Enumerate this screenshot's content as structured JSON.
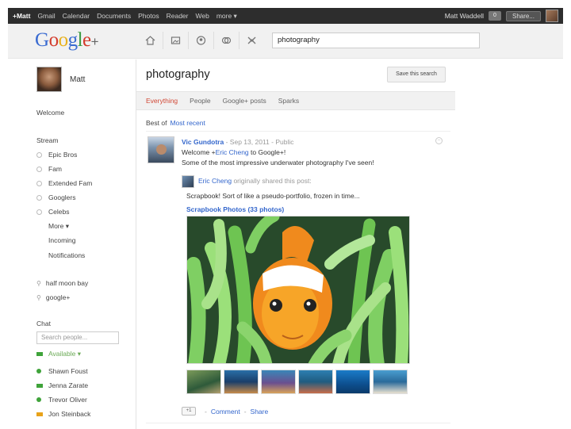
{
  "topbar": {
    "me": "+Matt",
    "nav": [
      "Gmail",
      "Calendar",
      "Documents",
      "Photos",
      "Reader",
      "Web",
      "more ▾"
    ],
    "user_name": "Matt Waddell",
    "share_label": "Share..."
  },
  "header": {
    "logo": "Google+",
    "search_value": "photography"
  },
  "sidebar": {
    "profile_name": "Matt",
    "welcome": "Welcome",
    "stream_label": "Stream",
    "circles": [
      "Epic Bros",
      "Fam",
      "Extended Fam",
      "Googlers",
      "Celebs"
    ],
    "more": "More ▾",
    "incoming": "Incoming",
    "notifications": "Notifications",
    "saved_searches": [
      "half moon bay",
      "google+"
    ],
    "chat_label": "Chat",
    "chat_search_placeholder": "Search people...",
    "availability": "Available ▾",
    "contacts": [
      "Shawn Foust",
      "Jenna Zarate",
      "Trevor Oliver",
      "Jon Steinback"
    ]
  },
  "main": {
    "title": "photography",
    "save_search": "Save this search",
    "tabs": [
      "Everything",
      "People",
      "Google+ posts",
      "Sparks"
    ],
    "best_of": "Best of",
    "most_recent": "Most recent",
    "post": {
      "author": "Vic Gundotra",
      "date": "Sep 13, 2011",
      "visibility": "Public",
      "line1_pre": "Welcome +",
      "line1_mention": "Eric Cheng",
      "line1_post": " to Google+!",
      "line2": "Some of the most impressive underwater photography I've seen!",
      "shared_author": "Eric Cheng",
      "shared_note": "originally shared this post:",
      "shared_text": "Scrapbook! Sort of like a pseudo-portfolio, frozen in time...",
      "album": "Scrapbook Photos (33 photos)",
      "plus_one": "+1",
      "comment": "Comment",
      "share": "Share"
    }
  },
  "colors": {
    "topbar_bg": "#2d2d2d",
    "active_tab": "#d14836",
    "link": "#3366cc",
    "chat_available": "#3fa33a"
  }
}
